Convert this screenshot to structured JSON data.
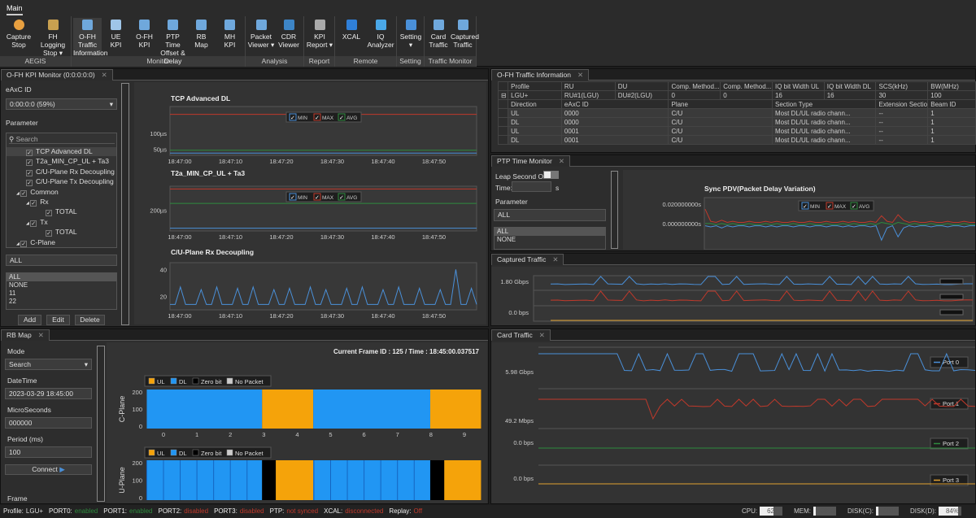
{
  "ribbon": {
    "tab": "Main",
    "groups": [
      {
        "label": "AEGIS",
        "buttons": [
          {
            "l1": "Capture",
            "l2": "Stop",
            "icon": "record-stop-icon",
            "color": "#e8a040"
          },
          {
            "l1": "FH Logging",
            "l2": "Stop ▾",
            "icon": "logging-icon",
            "color": "#c8a050"
          }
        ]
      },
      {
        "label": "Monitor",
        "buttons": [
          {
            "l1": "O-FH Traffic",
            "l2": "Information",
            "icon": "grid-icon",
            "color": "#6fa8dc"
          },
          {
            "l1": "UE",
            "l2": "KPI",
            "icon": "phone-icon",
            "color": "#9fc5e8"
          },
          {
            "l1": "O-FH",
            "l2": "KPI",
            "icon": "network-icon",
            "color": "#6fa8dc"
          },
          {
            "l1": "PTP Time",
            "l2": "Offset & Delay",
            "icon": "clock-network-icon",
            "color": "#6fa8dc"
          },
          {
            "l1": "RB",
            "l2": "Map",
            "icon": "table-icon",
            "color": "#6fa8dc"
          },
          {
            "l1": "MH",
            "l2": "KPI",
            "icon": "network-icon",
            "color": "#6fa8dc"
          }
        ]
      },
      {
        "label": "Analysis",
        "buttons": [
          {
            "l1": "Packet",
            "l2": "Viewer ▾",
            "icon": "filter-icon",
            "color": "#6fa8dc"
          },
          {
            "l1": "CDR",
            "l2": "Viewer",
            "icon": "c-logo-icon",
            "color": "#3d85c6"
          }
        ]
      },
      {
        "label": "Report",
        "buttons": [
          {
            "l1": "KPI",
            "l2": "Report ▾",
            "icon": "report-icon",
            "color": "#aaaaaa"
          }
        ]
      },
      {
        "label": "Remote",
        "buttons": [
          {
            "l1": "XCAL",
            "l2": "",
            "icon": "xcal-icon",
            "color": "#2f7fd8"
          },
          {
            "l1": "IQ",
            "l2": "Analyzer",
            "icon": "iq-icon",
            "color": "#4aa8e8"
          }
        ]
      },
      {
        "label": "Setting",
        "buttons": [
          {
            "l1": "Setting",
            "l2": "▾",
            "icon": "gear-icon",
            "color": "#4a90d9"
          }
        ]
      },
      {
        "label": "Traffic Monitor",
        "buttons": [
          {
            "l1": "Card",
            "l2": "Traffic",
            "icon": "card-traffic-icon",
            "color": "#6fa8dc"
          },
          {
            "l1": "Captured",
            "l2": "Traffic",
            "icon": "captured-traffic-icon",
            "color": "#6fa8dc"
          }
        ]
      }
    ]
  },
  "kpi": {
    "tab": "O-FH KPI Monitor (0:0:0:0:0)",
    "eaxc_label": "eAxC ID",
    "eaxc_value": "0:00:0:0 (59%)",
    "param_label": "Parameter",
    "search_placeholder": "Search",
    "tree": [
      {
        "label": "TCP Advanced DL",
        "level": 0
      },
      {
        "label": "T2a_MIN_CP_UL + Ta3",
        "level": 0
      },
      {
        "label": "C/U-Plane Rx Decoupling",
        "level": 0
      },
      {
        "label": "C/U-Plane Tx Decoupling",
        "level": 0
      },
      {
        "label": "Common",
        "level": 0,
        "exp": true
      },
      {
        "label": "Rx",
        "level": 1,
        "exp": true
      },
      {
        "label": "TOTAL",
        "level": 2
      },
      {
        "label": "Tx",
        "level": 1,
        "exp": true
      },
      {
        "label": "TOTAL",
        "level": 2
      },
      {
        "label": "C-Plane",
        "level": 0,
        "exp": true
      }
    ],
    "filter_value": "ALL",
    "list": [
      "ALL",
      "NONE",
      "11",
      "22"
    ],
    "add": "Add",
    "edit": "Edit",
    "delete": "Delete"
  },
  "legend": {
    "min": "MIN",
    "max": "MAX",
    "avg": "AVG"
  },
  "colors": {
    "min": "#4a90d9",
    "max": "#c0392b",
    "avg": "#2e8b3e",
    "ul": "#f5a30a",
    "dl": "#2196f3",
    "zero": "#000000",
    "nopacket": "#cccccc",
    "yellow": "#e0a030"
  },
  "kpi_charts": [
    {
      "title": "TCP Advanced DL",
      "yticks": [
        {
          "v": 100,
          "label": "100µs"
        },
        {
          "v": 50,
          "label": "50µs"
        }
      ],
      "ylim": [
        30,
        185
      ],
      "xticks": [
        "18:47:00",
        "18:47:10",
        "18:47:20",
        "18:47:30",
        "18:47:40",
        "18:47:50"
      ],
      "series": [
        {
          "color": "max",
          "values": [
            160,
            160,
            160,
            160,
            160,
            160
          ]
        },
        {
          "color": "avg",
          "values": [
            46,
            46,
            46,
            46,
            46,
            46
          ]
        },
        {
          "color": "min",
          "values": [
            37,
            37,
            37,
            37,
            37,
            37
          ]
        }
      ]
    },
    {
      "title": "T2a_MIN_CP_UL + Ta3",
      "yticks": [
        {
          "v": 200,
          "label": "200µs"
        }
      ],
      "ylim": [
        140,
        270
      ],
      "xticks": [
        "18:47:00",
        "18:47:10",
        "18:47:20",
        "18:47:30",
        "18:47:40",
        "18:47:50"
      ],
      "series": [
        {
          "color": "max",
          "values": [
            262,
            262,
            262,
            262,
            262,
            262
          ]
        },
        {
          "color": "avg",
          "values": [
            220,
            220,
            220,
            220,
            220,
            220
          ]
        },
        {
          "color": "min",
          "values": [
            148,
            148,
            148,
            148,
            148,
            148
          ]
        }
      ]
    },
    {
      "title": "C/U-Plane Rx Decoupling",
      "yticks": [
        {
          "v": 40,
          "label": "40"
        },
        {
          "v": 20,
          "label": "20"
        }
      ],
      "ylim": [
        10,
        45
      ],
      "xticks": [
        "18:47:00",
        "18:47:10",
        "18:47:20",
        "18:47:30",
        "18:47:40",
        "18:47:50"
      ],
      "series": [
        {
          "color": "min",
          "values": [
            14,
            14,
            27,
            14,
            14,
            14,
            25,
            14,
            14,
            27,
            14,
            14,
            14,
            26,
            14,
            14,
            27,
            14,
            14,
            14,
            25,
            14,
            14,
            26,
            14,
            14,
            14,
            27,
            14,
            14,
            25,
            14,
            14,
            14,
            26,
            14,
            14,
            27,
            14,
            14,
            14,
            25,
            14,
            14,
            27,
            14,
            14,
            14,
            26,
            14,
            14,
            14,
            25,
            14,
            14,
            40,
            14,
            14,
            26,
            14
          ]
        }
      ]
    }
  ],
  "rbmap": {
    "tab": "RB Map",
    "mode_label": "Mode",
    "mode_value": "Search",
    "datetime_label": "DateTime",
    "datetime_value": "2023-03-29 18:45:00",
    "micro_label": "MicroSeconds",
    "micro_value": "000000",
    "period_label": "Period (ms)",
    "period_value": "100",
    "connect": "Connect",
    "frame_label": "Frame",
    "frame_info": "Current Frame ID : 125 / Time :  18:45:00.037517",
    "legend": [
      "UL",
      "DL",
      "Zero bit",
      "No Packet"
    ],
    "xticks": [
      "0",
      "1",
      "2",
      "3",
      "4",
      "5",
      "6",
      "7",
      "8",
      "9"
    ],
    "cplane": {
      "label": "C-Plane",
      "yticks": [
        "200",
        "100",
        "0"
      ],
      "blocks": [
        {
          "type": "dl",
          "from": -0.5,
          "to": 2.95
        },
        {
          "type": "ul",
          "from": 2.95,
          "to": 4.48
        },
        {
          "type": "dl",
          "from": 4.48,
          "to": 7.98
        },
        {
          "type": "ul",
          "from": 7.98,
          "to": 9.5
        }
      ]
    },
    "uplane": {
      "label": "U-Plane",
      "yticks": [
        "200",
        "100",
        "0"
      ],
      "blocks": [
        {
          "type": "dl",
          "from": -0.5,
          "to": 2.95
        },
        {
          "type": "zero",
          "from": 2.95,
          "to": 3.36
        },
        {
          "type": "ul",
          "from": 3.36,
          "to": 4.48
        },
        {
          "type": "dl",
          "from": 4.48,
          "to": 7.98
        },
        {
          "type": "zero",
          "from": 7.98,
          "to": 8.4
        },
        {
          "type": "ul",
          "from": 8.4,
          "to": 9.5
        }
      ]
    }
  },
  "traffic_info": {
    "tab": "O-FH Traffic Information",
    "headers": [
      "Profile",
      "RU",
      "DU",
      "Comp. Method...",
      "Comp. Method...",
      "IQ bit Width UL",
      "IQ bit Width DL",
      "SCS(kHz)",
      "BW(MHz)"
    ],
    "profile_row": [
      "LGU+",
      "RU#1(LGU)",
      "DU#2(LGU)",
      "0",
      "0",
      "16",
      "16",
      "30",
      "100"
    ],
    "sub_headers": [
      "Direction",
      "eAxC ID",
      "Plane",
      "Section Type",
      "Extension Section Type",
      "Beam ID"
    ],
    "rows": [
      [
        "UL",
        "0000",
        "C/U",
        "Most DL/UL radio chann...",
        "--",
        "1"
      ],
      [
        "DL",
        "0000",
        "C/U",
        "Most DL/UL radio chann...",
        "--",
        "1"
      ],
      [
        "UL",
        "0001",
        "C/U",
        "Most DL/UL radio chann...",
        "--",
        "1"
      ],
      [
        "DL",
        "0001",
        "C/U",
        "Most DL/UL radio chann...",
        "--",
        "1"
      ]
    ]
  },
  "ptp": {
    "tab": "PTP Time Monitor",
    "leap_label": "Leap Second Off",
    "time_label": "Time:",
    "time_unit": "s",
    "param_label": "Parameter",
    "filter_value": "ALL",
    "list": [
      "ALL",
      "NONE"
    ],
    "chart": {
      "title": "Sync PDV(Packet Delay Variation)",
      "yticks": [
        "0.020000000s",
        "0.000000000s"
      ],
      "max": [
        14,
        3,
        2,
        4,
        2,
        3,
        2,
        2,
        3,
        2,
        2,
        3,
        2,
        3,
        2,
        2,
        3,
        2,
        2,
        3,
        2,
        2,
        3,
        2,
        2,
        3,
        2,
        3,
        2,
        2,
        3,
        2,
        8,
        3,
        2,
        9,
        4,
        2,
        3,
        2,
        2,
        3,
        2,
        2,
        3,
        2,
        2,
        3,
        2,
        2
      ],
      "avg": [
        1,
        1,
        0,
        1,
        0,
        1,
        0,
        0,
        1,
        0,
        0,
        1,
        0,
        1,
        0,
        0,
        1,
        0,
        0,
        1,
        0,
        0,
        1,
        0,
        0,
        1,
        0,
        1,
        0,
        0,
        1,
        0,
        2,
        1,
        0,
        2,
        1,
        0,
        1,
        0,
        0,
        1,
        0,
        0,
        1,
        0,
        0,
        1,
        0,
        0
      ],
      "min": [
        -1,
        -2,
        -1,
        -3,
        -1,
        -2,
        -1,
        -1,
        -2,
        -1,
        -1,
        -2,
        -1,
        -2,
        -1,
        -1,
        -2,
        -1,
        -1,
        -2,
        -1,
        -1,
        -2,
        -1,
        -1,
        -2,
        -1,
        -2,
        -1,
        -1,
        -2,
        -1,
        -14,
        -3,
        -1,
        -11,
        -3,
        -1,
        -2,
        -1,
        -1,
        -2,
        -1,
        -1,
        -2,
        -1,
        -1,
        -2,
        -1,
        -1
      ]
    }
  },
  "captured": {
    "tab": "Captured Traffic",
    "ylabels": [
      "1.80 Gbps",
      "0.0 bps"
    ]
  },
  "card": {
    "tab": "Card Traffic",
    "rows": [
      {
        "label": "5.98 Gbps",
        "port": "Port 0",
        "color": "#4a90d9"
      },
      {
        "label": "49.2 Mbps",
        "port": "Port 1",
        "color": "#c0392b"
      },
      {
        "label": "0.0 bps",
        "port": "Port 2",
        "color": "#2e8b3e"
      },
      {
        "label": "0.0 bps",
        "port": "Port 3",
        "color": "#e0a030"
      }
    ]
  },
  "status": {
    "items": [
      {
        "k": "Profile:",
        "v": "LGU+",
        "c": "#dddddd"
      },
      {
        "k": "PORT0:",
        "v": "enabled",
        "c": "#2e8b3e"
      },
      {
        "k": "PORT1:",
        "v": "enabled",
        "c": "#2e8b3e"
      },
      {
        "k": "PORT2:",
        "v": "disabled",
        "c": "#c0392b"
      },
      {
        "k": "PORT3:",
        "v": "disabled",
        "c": "#c0392b"
      },
      {
        "k": "PTP:",
        "v": "not synced",
        "c": "#c0392b"
      },
      {
        "k": "XCAL:",
        "v": "disconnected",
        "c": "#c0392b"
      },
      {
        "k": "Replay:",
        "v": "Off",
        "c": "#c0392b"
      }
    ],
    "meters": [
      {
        "k": "CPU:",
        "v": "62%",
        "pct": 62
      },
      {
        "k": "MEM:",
        "v": "30%",
        "pct": 30
      },
      {
        "k": "DISK(C):",
        "v": "30%",
        "pct": 30
      },
      {
        "k": "DISK(D):",
        "v": "84%",
        "pct": 84
      }
    ]
  }
}
